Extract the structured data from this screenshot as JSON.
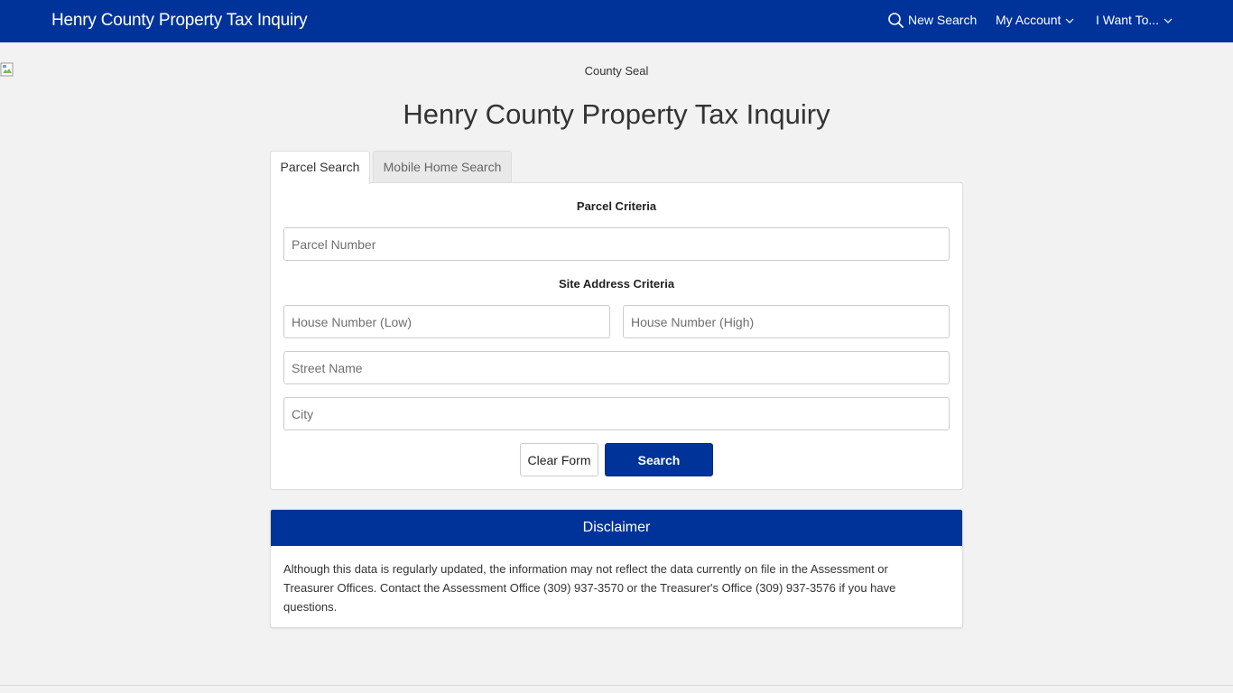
{
  "nav": {
    "brand": "Henry County Property Tax Inquiry",
    "new_search": "New Search",
    "my_account": "My Account",
    "i_want_to": "I Want To..."
  },
  "header": {
    "seal_alt": "County Seal",
    "title": "Henry County Property Tax Inquiry"
  },
  "tabs": [
    {
      "label": "Parcel Search",
      "active": true
    },
    {
      "label": "Mobile Home Search",
      "active": false
    }
  ],
  "form": {
    "parcel_criteria_label": "Parcel Criteria",
    "parcel_number_placeholder": "Parcel Number",
    "site_address_label": "Site Address Criteria",
    "house_low_placeholder": "House Number (Low)",
    "house_high_placeholder": "House Number (High)",
    "street_placeholder": "Street Name",
    "city_placeholder": "City",
    "clear_label": "Clear Form",
    "search_label": "Search"
  },
  "disclaimer": {
    "title": "Disclaimer",
    "text": "Although this data is regularly updated, the information may not reflect the data currently on file in the Assessment or Treasurer Offices. Contact the Assessment Office (309) 937-3570 or the Treasurer's Office (309) 937-3576 if you have questions."
  },
  "colors": {
    "brand_blue": "#00339a",
    "page_bg": "#f2f2f2"
  },
  "icons": [
    "search-icon",
    "chevron-down-icon",
    "broken-image-icon"
  ]
}
